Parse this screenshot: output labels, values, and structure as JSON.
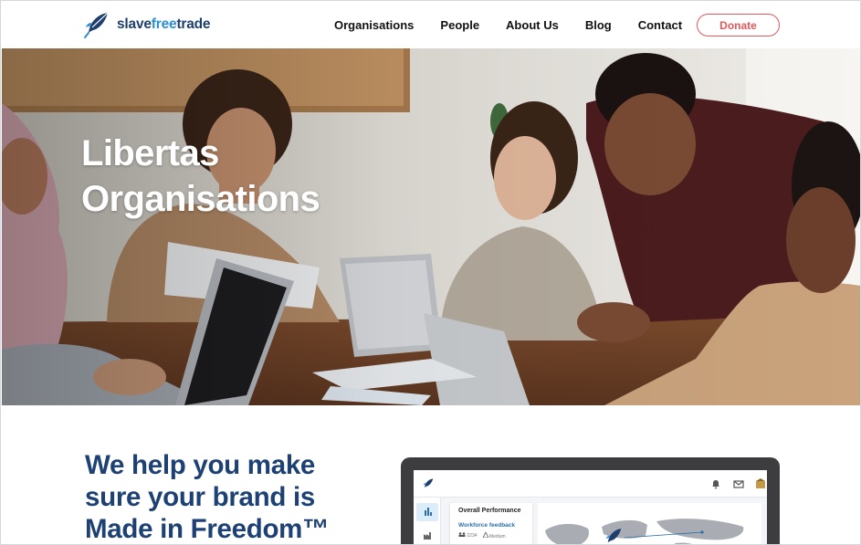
{
  "brand": {
    "name_part1": "slave",
    "name_part2": "free",
    "name_part3": "trade",
    "colors": {
      "navy": "#1e3f6e",
      "sky": "#2a8fd4",
      "accent": "#e0595b"
    }
  },
  "nav": {
    "items": [
      {
        "label": "Organisations"
      },
      {
        "label": "People"
      },
      {
        "label": "About Us"
      },
      {
        "label": "Blog"
      },
      {
        "label": "Contact"
      }
    ],
    "donate_label": "Donate"
  },
  "hero": {
    "title_line1": "Libertas",
    "title_line2": "Organisations"
  },
  "section": {
    "headline_line1": "We help you make",
    "headline_line2": "sure your brand is",
    "headline_line3": "Made in Freedom™"
  },
  "dashboard": {
    "card_title": "Overall Performance",
    "card_subtitle": "Workforce feedback",
    "stat_1": "2234",
    "stat_2": "Medium"
  }
}
